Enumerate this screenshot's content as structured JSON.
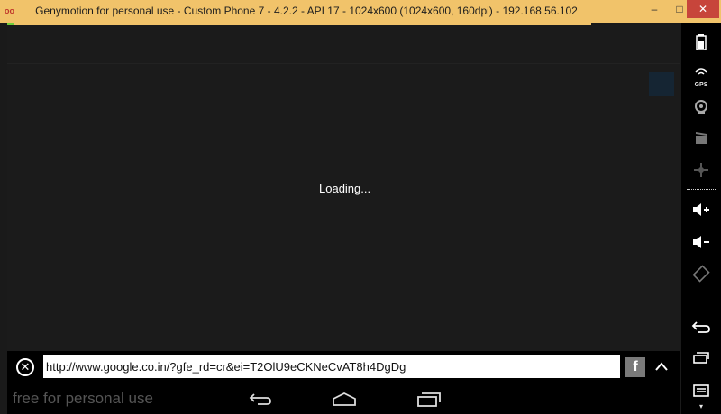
{
  "window": {
    "title": "Genymotion for personal use - Custom Phone 7 - 4.2.2 - API 17 - 1024x600 (1024x600, 160dpi) - 192.168.56.102",
    "app_icon": "oo",
    "minimize": "–",
    "maximize": "□",
    "close": "✕"
  },
  "screen": {
    "loading_text": "Loading..."
  },
  "urlbar": {
    "url": "http://www.google.co.in/?gfe_rd=cr&ei=T2OlU9eCKNeCvAT8h4DgDg",
    "share_label": "f",
    "collapse_glyph": "⌃"
  },
  "navbar": {
    "watermark": "free for personal use"
  },
  "toolbar_icons": [
    {
      "name": "battery-icon"
    },
    {
      "name": "gps-icon",
      "label": "GPS"
    },
    {
      "name": "webcam-icon"
    },
    {
      "name": "screencast-icon"
    },
    {
      "name": "dpad-icon"
    },
    {
      "name": "volume-up-icon"
    },
    {
      "name": "volume-down-icon"
    },
    {
      "name": "rotate-icon"
    },
    {
      "name": "back-icon"
    },
    {
      "name": "recent-apps-icon"
    },
    {
      "name": "menu-icon"
    }
  ],
  "colors": {
    "titlebar": "#f1c36a",
    "close_button": "#c7453b",
    "screen_bg": "#1b1b1b",
    "toolbar_bg": "#000000"
  }
}
